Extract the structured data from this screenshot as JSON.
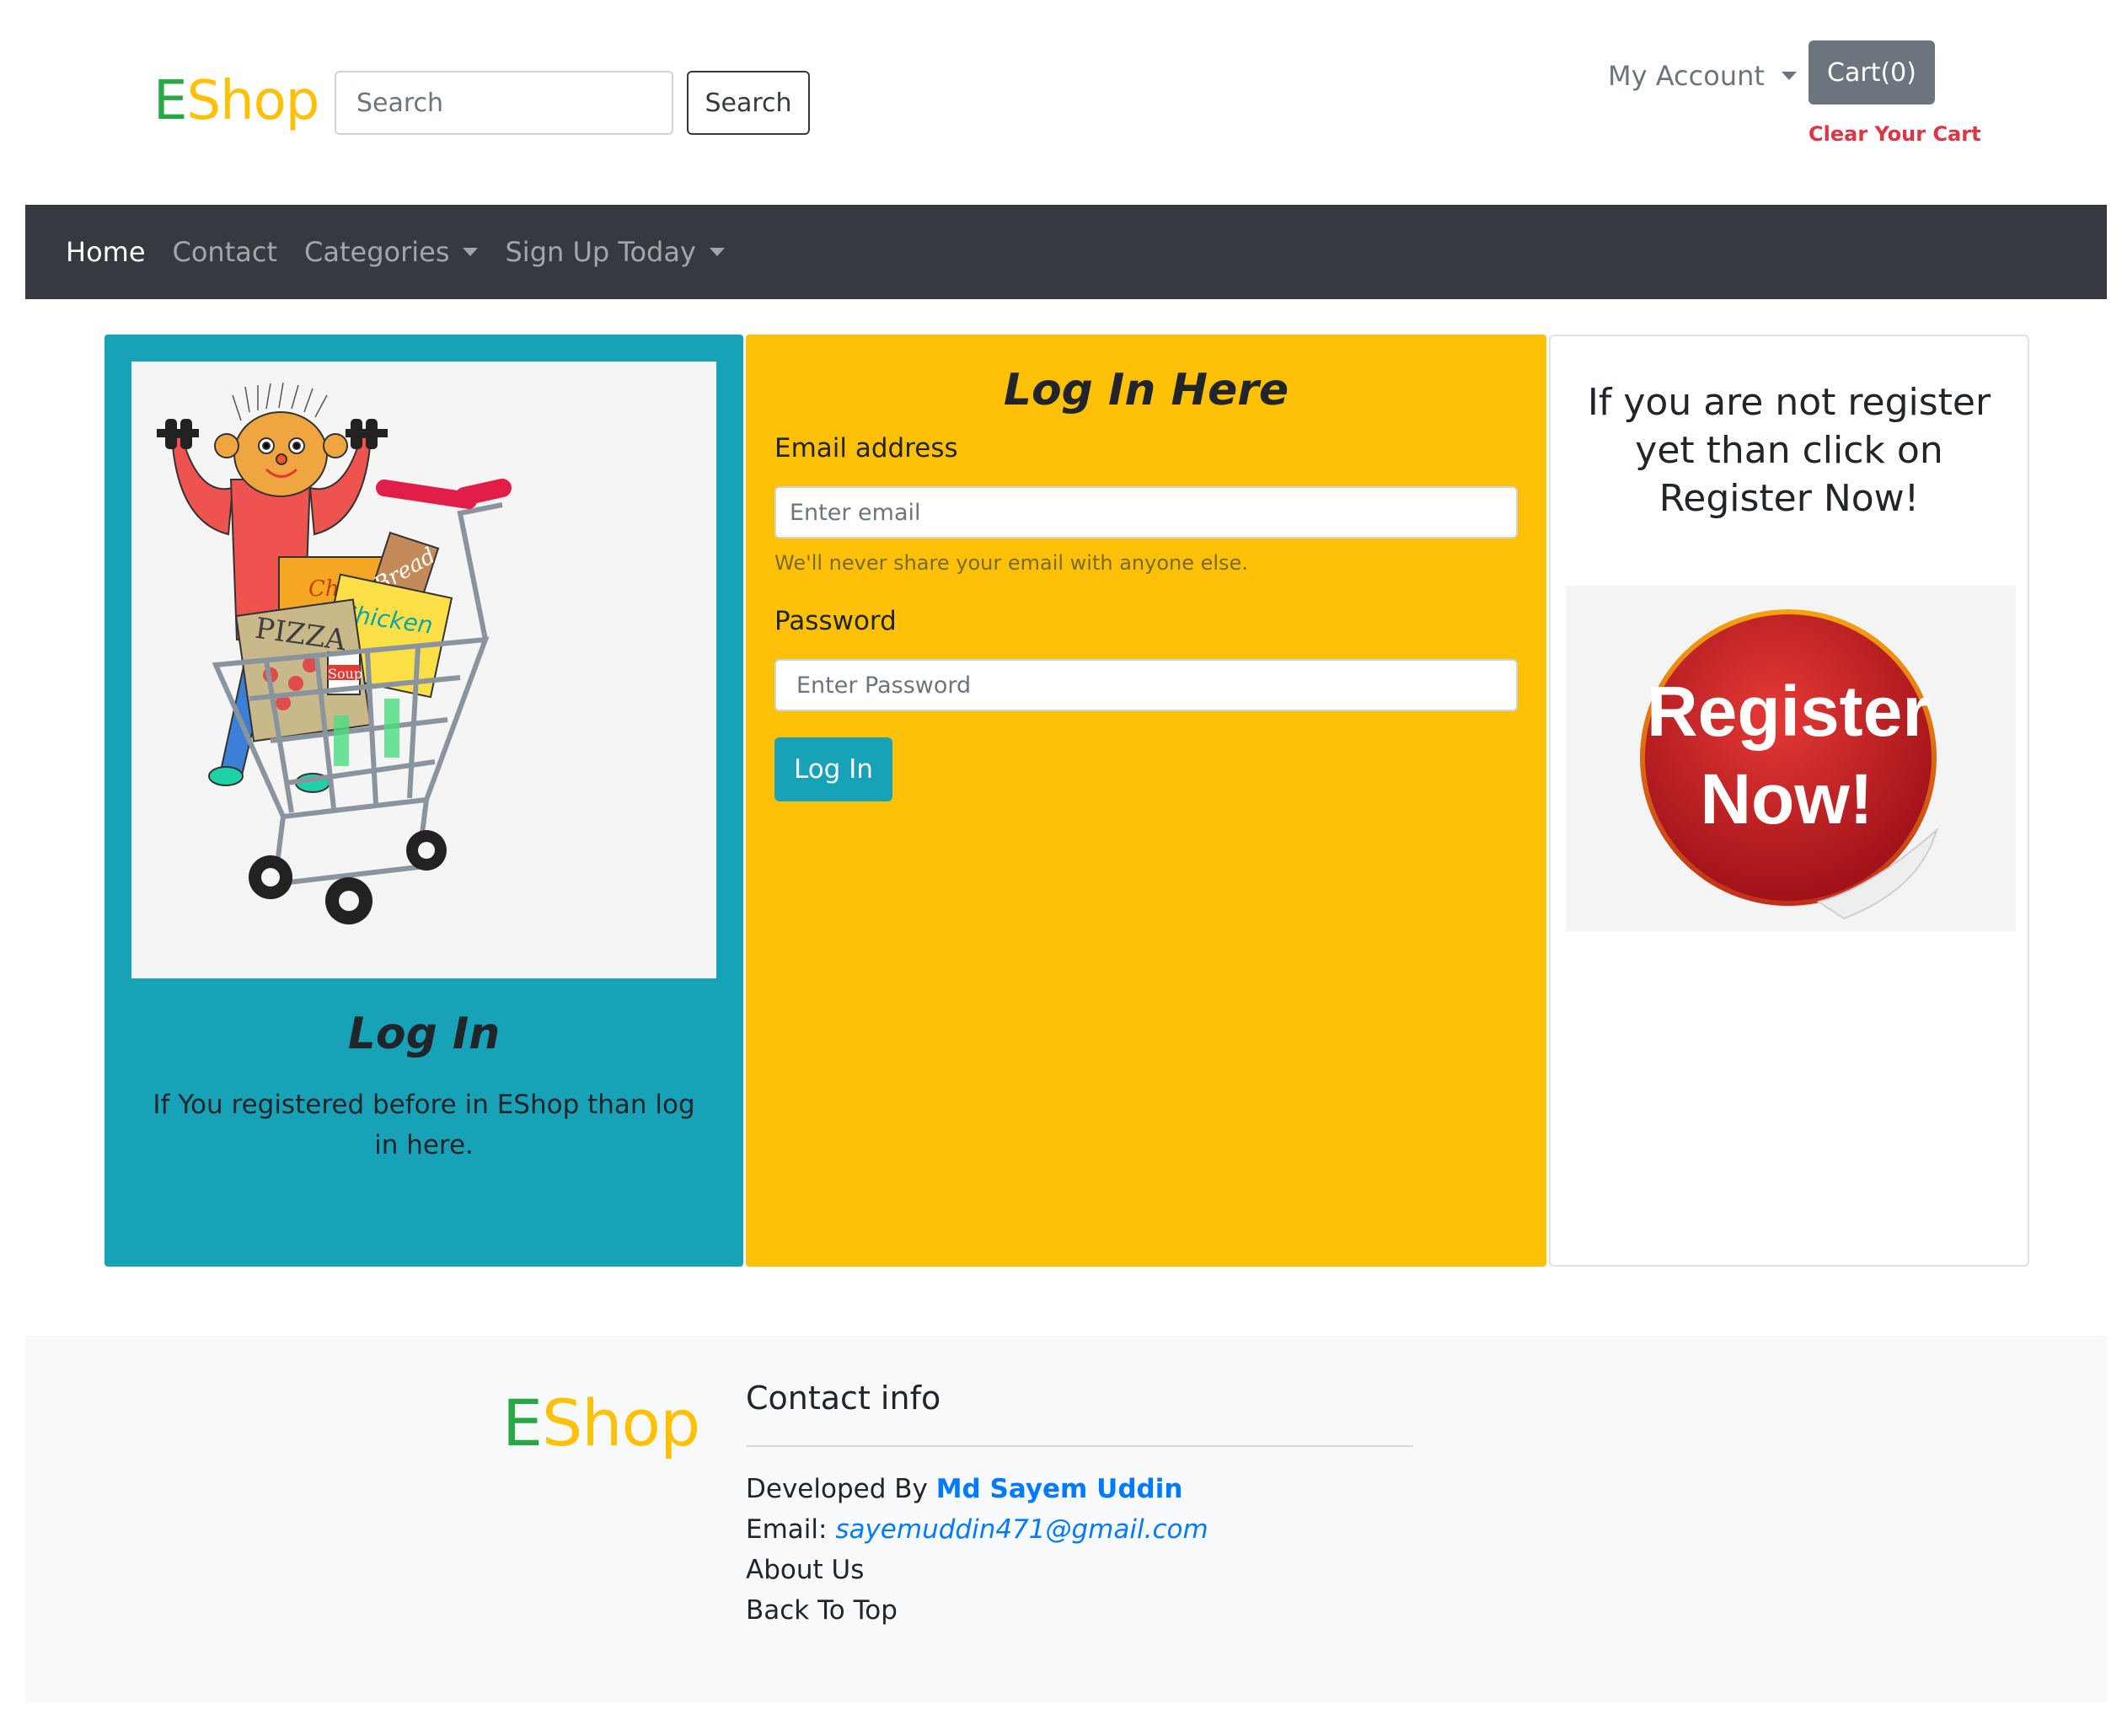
{
  "header": {
    "brand_first": "E",
    "brand_rest": "Shop",
    "search_placeholder": "Search",
    "search_button": "Search",
    "account_label": "My Account",
    "cart_label": "Cart(0)",
    "clear_cart": "Clear Your Cart"
  },
  "nav": {
    "home": "Home",
    "contact": "Contact",
    "categories": "Categories",
    "signup": "Sign Up Today"
  },
  "login_card": {
    "title": "Log In",
    "text": "If You registered before in EShop than log in here.",
    "image_labels": {
      "cheese": "Cheese",
      "bread": "Bread",
      "pizza": "PIZZA",
      "chicken": "Chicken",
      "soup": "Soup"
    }
  },
  "form": {
    "title": "Log In Here",
    "email_label": "Email address",
    "email_placeholder": "Enter email",
    "email_help": "We'll never share your email with anyone else.",
    "password_label": "Password",
    "password_placeholder": "Enter Password",
    "submit": "Log In"
  },
  "register_card": {
    "text": "If you are not register yet than click on Register Now!",
    "sticker_line1": "Register",
    "sticker_line2": "Now!"
  },
  "footer": {
    "brand_first": "E",
    "brand_rest": "Shop",
    "contact_title": "Contact info",
    "developed_prefix": "Developed By ",
    "developer": "Md Sayem Uddin",
    "email_prefix": "Email: ",
    "email": "sayemuddin471@gmail.com",
    "about": "About Us",
    "back_to_top": "Back To Top"
  },
  "colors": {
    "brand_green": "#28a745",
    "brand_yellow": "#ffc107",
    "navbar": "#343a40",
    "info": "#17a2b8",
    "danger": "#dc3545",
    "link": "#007bff"
  }
}
